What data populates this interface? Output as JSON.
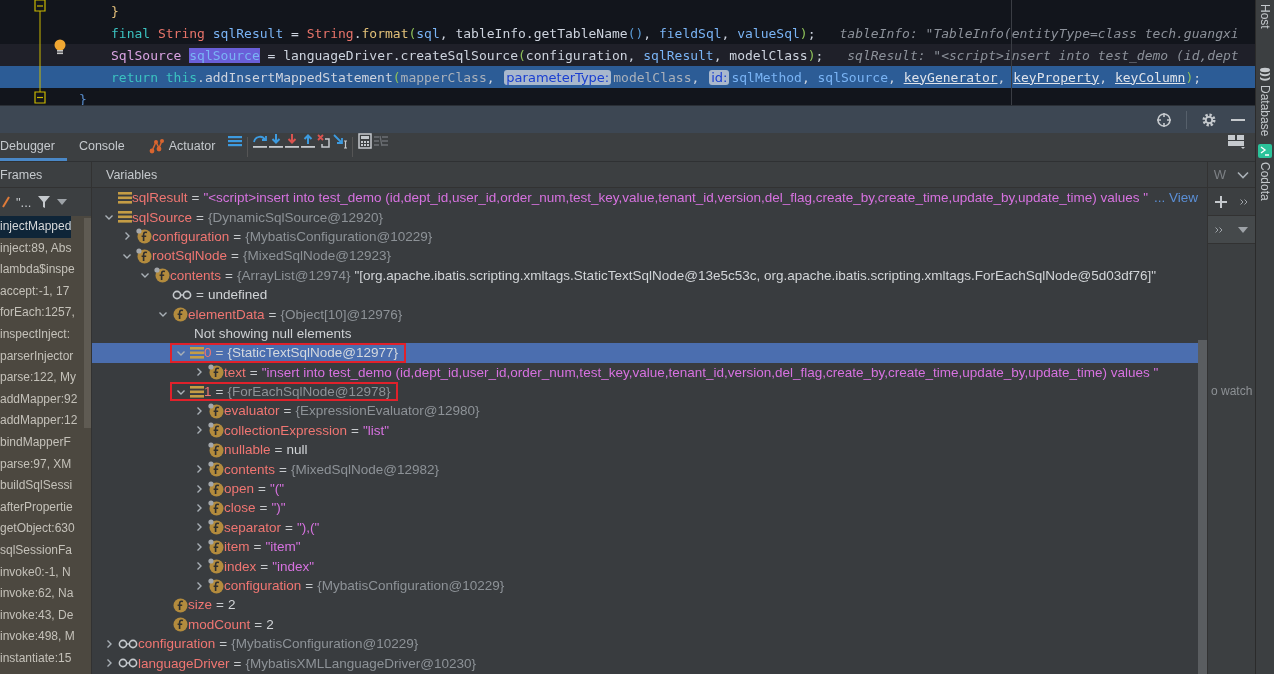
{
  "editor": {
    "lines": [
      {
        "kind": "body",
        "caret_line": false,
        "execution_point": false,
        "tokens": [
          {
            "text": "}",
            "kind": "brace"
          }
        ]
      },
      {
        "kind": "body",
        "caret_line": false,
        "execution_point": false,
        "tokens": [
          {
            "text": "final ",
            "kind": "keyword"
          },
          {
            "text": "String ",
            "kind": "type"
          },
          {
            "text": "sqlResult",
            "kind": "variable"
          },
          {
            "text": " = ",
            "kind": "plain"
          },
          {
            "text": "String",
            "kind": "type"
          },
          {
            "text": ".",
            "kind": "plain"
          },
          {
            "text": "format",
            "kind": "method"
          },
          {
            "text": "(",
            "kind": "paren"
          },
          {
            "text": "sql",
            "kind": "variable"
          },
          {
            "text": ", tableInfo.getTableName",
            "kind": "plain"
          },
          {
            "text": "()",
            "kind": "call_paren"
          },
          {
            "text": ", ",
            "kind": "plain"
          },
          {
            "text": "fieldSql",
            "kind": "variable"
          },
          {
            "text": ", ",
            "kind": "plain"
          },
          {
            "text": "valueSql",
            "kind": "variable"
          },
          {
            "text": ")",
            "kind": "paren"
          },
          {
            "text": ";",
            "kind": "plain"
          }
        ],
        "inline_value": "tableInfo: \"TableInfo(entityType=class tech.guangxi"
      },
      {
        "kind": "body",
        "caret_line": true,
        "execution_point": false,
        "tokens": [
          {
            "text": "SqlSource ",
            "kind": "class"
          },
          {
            "text": "sqlSource",
            "kind": "occurrence"
          },
          {
            "text": " = languageDriver.createSqlSource",
            "kind": "plain"
          },
          {
            "text": "(",
            "kind": "paren"
          },
          {
            "text": "configuration, ",
            "kind": "plain"
          },
          {
            "text": "sqlResult",
            "kind": "variable"
          },
          {
            "text": ", modelClass",
            "kind": "plain"
          },
          {
            "text": ")",
            "kind": "paren"
          },
          {
            "text": ";",
            "kind": "plain"
          }
        ],
        "inline_value": "sqlResult: \"<script>insert into test_demo (id,dept"
      },
      {
        "kind": "body",
        "caret_line": false,
        "execution_point": true,
        "tokens": [
          {
            "text": "return ",
            "kind": "keyword"
          },
          {
            "text": "this",
            "kind": "keyword"
          },
          {
            "text": ".addInsertMappedStatement",
            "kind": "plain"
          },
          {
            "text": "(",
            "kind": "paren"
          },
          {
            "text": "mapperClass",
            "kind": "dim"
          },
          {
            "text": ", ",
            "kind": "plain"
          },
          {
            "text": "parameterType:",
            "kind": "hint"
          },
          {
            "text": "modelClass",
            "kind": "dim"
          },
          {
            "text": ", ",
            "kind": "plain"
          },
          {
            "text": "id:",
            "kind": "hint"
          },
          {
            "text": "sqlMethod",
            "kind": "variable"
          },
          {
            "text": ", ",
            "kind": "plain"
          },
          {
            "text": "sqlSource",
            "kind": "variable"
          },
          {
            "text": ", ",
            "kind": "plain"
          },
          {
            "text": "keyGenerator",
            "kind": "field"
          },
          {
            "text": ", ",
            "kind": "plain"
          },
          {
            "text": "keyProperty",
            "kind": "field"
          },
          {
            "text": ", ",
            "kind": "plain"
          },
          {
            "text": "keyColumn",
            "kind": "field"
          },
          {
            "text": ")",
            "kind": "paren"
          },
          {
            "text": ";",
            "kind": "plain"
          }
        ]
      },
      {
        "kind": "block_end",
        "caret_line": false,
        "execution_point": false,
        "tokens": [
          {
            "text": "}",
            "kind": "brace_end"
          }
        ]
      }
    ]
  },
  "tabs": [
    {
      "label": "Debugger",
      "selected": true,
      "kind": "plain"
    },
    {
      "label": "Console",
      "selected": false,
      "kind": "plain"
    },
    {
      "label": "Actuator",
      "selected": false,
      "kind": "plugin"
    }
  ],
  "frames_panel": {
    "title": "Frames",
    "thread": "\"...",
    "items": [
      {
        "label": "injectMapped",
        "selected": true
      },
      {
        "label": "inject:89, Abs",
        "selected": false
      },
      {
        "label": "lambda$inspe",
        "selected": false
      },
      {
        "label": "accept:-1, 17",
        "selected": false
      },
      {
        "label": "forEach:1257,",
        "selected": false
      },
      {
        "label": "inspectInject:",
        "selected": false
      },
      {
        "label": "parserInjector",
        "selected": false
      },
      {
        "label": "parse:122, My",
        "selected": false
      },
      {
        "label": "addMapper:92",
        "selected": false
      },
      {
        "label": "addMapper:12",
        "selected": false
      },
      {
        "label": "bindMapperF",
        "selected": false
      },
      {
        "label": "parse:97, XM",
        "selected": false
      },
      {
        "label": "buildSqlSessi",
        "selected": false
      },
      {
        "label": "afterPropertie",
        "selected": false
      },
      {
        "label": "getObject:630",
        "selected": false
      },
      {
        "label": "sqlSessionFa",
        "selected": false
      },
      {
        "label": "invoke0:-1, N",
        "selected": false
      },
      {
        "label": "invoke:62, Na",
        "selected": false
      },
      {
        "label": "invoke:43, De",
        "selected": false
      },
      {
        "label": "invoke:498, M",
        "selected": false
      },
      {
        "label": "instantiate:15",
        "selected": false
      }
    ]
  },
  "variables_panel": {
    "title": "Variables",
    "nodes": [
      {
        "kind": "local",
        "name": "sqlResult",
        "operator": "=",
        "value": {
          "text": "\"<script>insert into test_demo (id,dept_id,user_id,order_num,test_key,value,tenant_id,version,del_flag,create_by,create_time,update_by,update_time) values \"",
          "kind": "string"
        },
        "link": "... View",
        "selected": false,
        "highlighted": false
      },
      {
        "kind": "local",
        "expanded": true,
        "name": "sqlSource",
        "operator": "=",
        "value": {
          "text": "{DynamicSqlSource@12920}",
          "kind": "object"
        },
        "selected": false,
        "highlighted": false,
        "children": [
          {
            "kind": "field",
            "final": true,
            "expanded": false,
            "name": "configuration",
            "operator": "=",
            "value": {
              "text": "{MybatisConfiguration@10229}",
              "kind": "object"
            },
            "selected": false,
            "highlighted": false
          },
          {
            "kind": "field",
            "final": true,
            "expanded": true,
            "name": "rootSqlNode",
            "operator": "=",
            "value": {
              "text": "{MixedSqlNode@12923}",
              "kind": "object"
            },
            "selected": false,
            "highlighted": false,
            "children": [
              {
                "kind": "field",
                "final": true,
                "expanded": true,
                "name": "contents",
                "operator": "=",
                "value": {
                  "text": "{ArrayList@12974}",
                  "kind": "object"
                },
                "summary": "\"[org.apache.ibatis.scripting.xmltags.StaticTextSqlNode@13e5c53c, org.apache.ibatis.scripting.xmltags.ForEachSqlNode@5d03df76]\"",
                "selected": false,
                "highlighted": false,
                "children": [
                  {
                    "kind": "watch",
                    "operator": "=",
                    "value": {
                      "text": "undefined",
                      "kind": "plain"
                    },
                    "selected": false,
                    "highlighted": false
                  },
                  {
                    "kind": "field",
                    "final": false,
                    "expanded": true,
                    "name": "elementData",
                    "operator": "=",
                    "value": {
                      "text": "{Object[10]@12976}",
                      "kind": "object"
                    },
                    "selected": false,
                    "highlighted": false,
                    "children": [
                      {
                        "kind": "message",
                        "message": "Not showing null elements",
                        "selected": false,
                        "highlighted": false
                      },
                      {
                        "kind": "local",
                        "expanded": true,
                        "name": "0",
                        "operator": "=",
                        "value": {
                          "text": "{StaticTextSqlNode@12977}",
                          "kind": "object"
                        },
                        "selected": true,
                        "highlighted": true,
                        "children": [
                          {
                            "kind": "field",
                            "final": true,
                            "expanded": false,
                            "name": "text",
                            "operator": "=",
                            "value": {
                              "text": "\"insert into test_demo (id,dept_id,user_id,order_num,test_key,value,tenant_id,version,del_flag,create_by,create_time,update_by,update_time) values \"",
                              "kind": "string"
                            },
                            "selected": false,
                            "highlighted": false
                          }
                        ]
                      },
                      {
                        "kind": "local",
                        "expanded": true,
                        "name": "1",
                        "operator": "=",
                        "value": {
                          "text": "{ForEachSqlNode@12978}",
                          "kind": "object"
                        },
                        "selected": false,
                        "highlighted": true,
                        "children": [
                          {
                            "kind": "field",
                            "final": true,
                            "expanded": false,
                            "name": "evaluator",
                            "operator": "=",
                            "value": {
                              "text": "{ExpressionEvaluator@12980}",
                              "kind": "object"
                            },
                            "selected": false,
                            "highlighted": false
                          },
                          {
                            "kind": "field",
                            "final": true,
                            "expanded": false,
                            "name": "collectionExpression",
                            "operator": "=",
                            "value": {
                              "text": "\"list\"",
                              "kind": "string"
                            },
                            "selected": false,
                            "highlighted": false
                          },
                          {
                            "kind": "field",
                            "final": true,
                            "name": "nullable",
                            "operator": "=",
                            "value": {
                              "text": "null",
                              "kind": "plain"
                            },
                            "selected": false,
                            "highlighted": false
                          },
                          {
                            "kind": "field",
                            "final": true,
                            "expanded": false,
                            "name": "contents",
                            "operator": "=",
                            "value": {
                              "text": "{MixedSqlNode@12982}",
                              "kind": "object"
                            },
                            "selected": false,
                            "highlighted": false
                          },
                          {
                            "kind": "field",
                            "final": true,
                            "expanded": false,
                            "name": "open",
                            "operator": "=",
                            "value": {
                              "text": "\"(\"",
                              "kind": "string"
                            },
                            "selected": false,
                            "highlighted": false
                          },
                          {
                            "kind": "field",
                            "final": true,
                            "expanded": false,
                            "name": "close",
                            "operator": "=",
                            "value": {
                              "text": "\")\"",
                              "kind": "string"
                            },
                            "selected": false,
                            "highlighted": false
                          },
                          {
                            "kind": "field",
                            "final": true,
                            "expanded": false,
                            "name": "separator",
                            "operator": "=",
                            "value": {
                              "text": "\"),(\"",
                              "kind": "string"
                            },
                            "selected": false,
                            "highlighted": false
                          },
                          {
                            "kind": "field",
                            "final": true,
                            "expanded": false,
                            "name": "item",
                            "operator": "=",
                            "value": {
                              "text": "\"item\"",
                              "kind": "string"
                            },
                            "selected": false,
                            "highlighted": false
                          },
                          {
                            "kind": "field",
                            "final": true,
                            "expanded": false,
                            "name": "index",
                            "operator": "=",
                            "value": {
                              "text": "\"index\"",
                              "kind": "string"
                            },
                            "selected": false,
                            "highlighted": false
                          },
                          {
                            "kind": "field",
                            "final": true,
                            "expanded": false,
                            "name": "configuration",
                            "operator": "=",
                            "value": {
                              "text": "{MybatisConfiguration@10229}",
                              "kind": "object"
                            },
                            "selected": false,
                            "highlighted": false
                          }
                        ]
                      }
                    ]
                  },
                  {
                    "kind": "field",
                    "final": false,
                    "name": "size",
                    "operator": "=",
                    "value": {
                      "text": "2",
                      "kind": "plain"
                    },
                    "selected": false,
                    "highlighted": false
                  },
                  {
                    "kind": "field",
                    "final": false,
                    "name": "modCount",
                    "operator": "=",
                    "value": {
                      "text": "2",
                      "kind": "plain"
                    },
                    "selected": false,
                    "highlighted": false
                  }
                ]
              }
            ]
          }
        ]
      },
      {
        "kind": "watch",
        "expanded": false,
        "name": "configuration",
        "operator": "=",
        "value": {
          "text": "{MybatisConfiguration@10229}",
          "kind": "object"
        },
        "selected": false,
        "highlighted": false
      },
      {
        "kind": "watch",
        "expanded": false,
        "name": "languageDriver",
        "operator": "=",
        "value": {
          "text": "{MybatisXMLLanguageDriver@10230}",
          "kind": "object"
        },
        "selected": false,
        "highlighted": false
      }
    ]
  },
  "watches_panel": {
    "title": "W",
    "empty_text": "o watch"
  },
  "side_strip": [
    {
      "label": "Host",
      "kind": "plain"
    },
    {
      "label": "Database",
      "kind": "database"
    },
    {
      "label": "Codota",
      "kind": "codota"
    }
  ]
}
